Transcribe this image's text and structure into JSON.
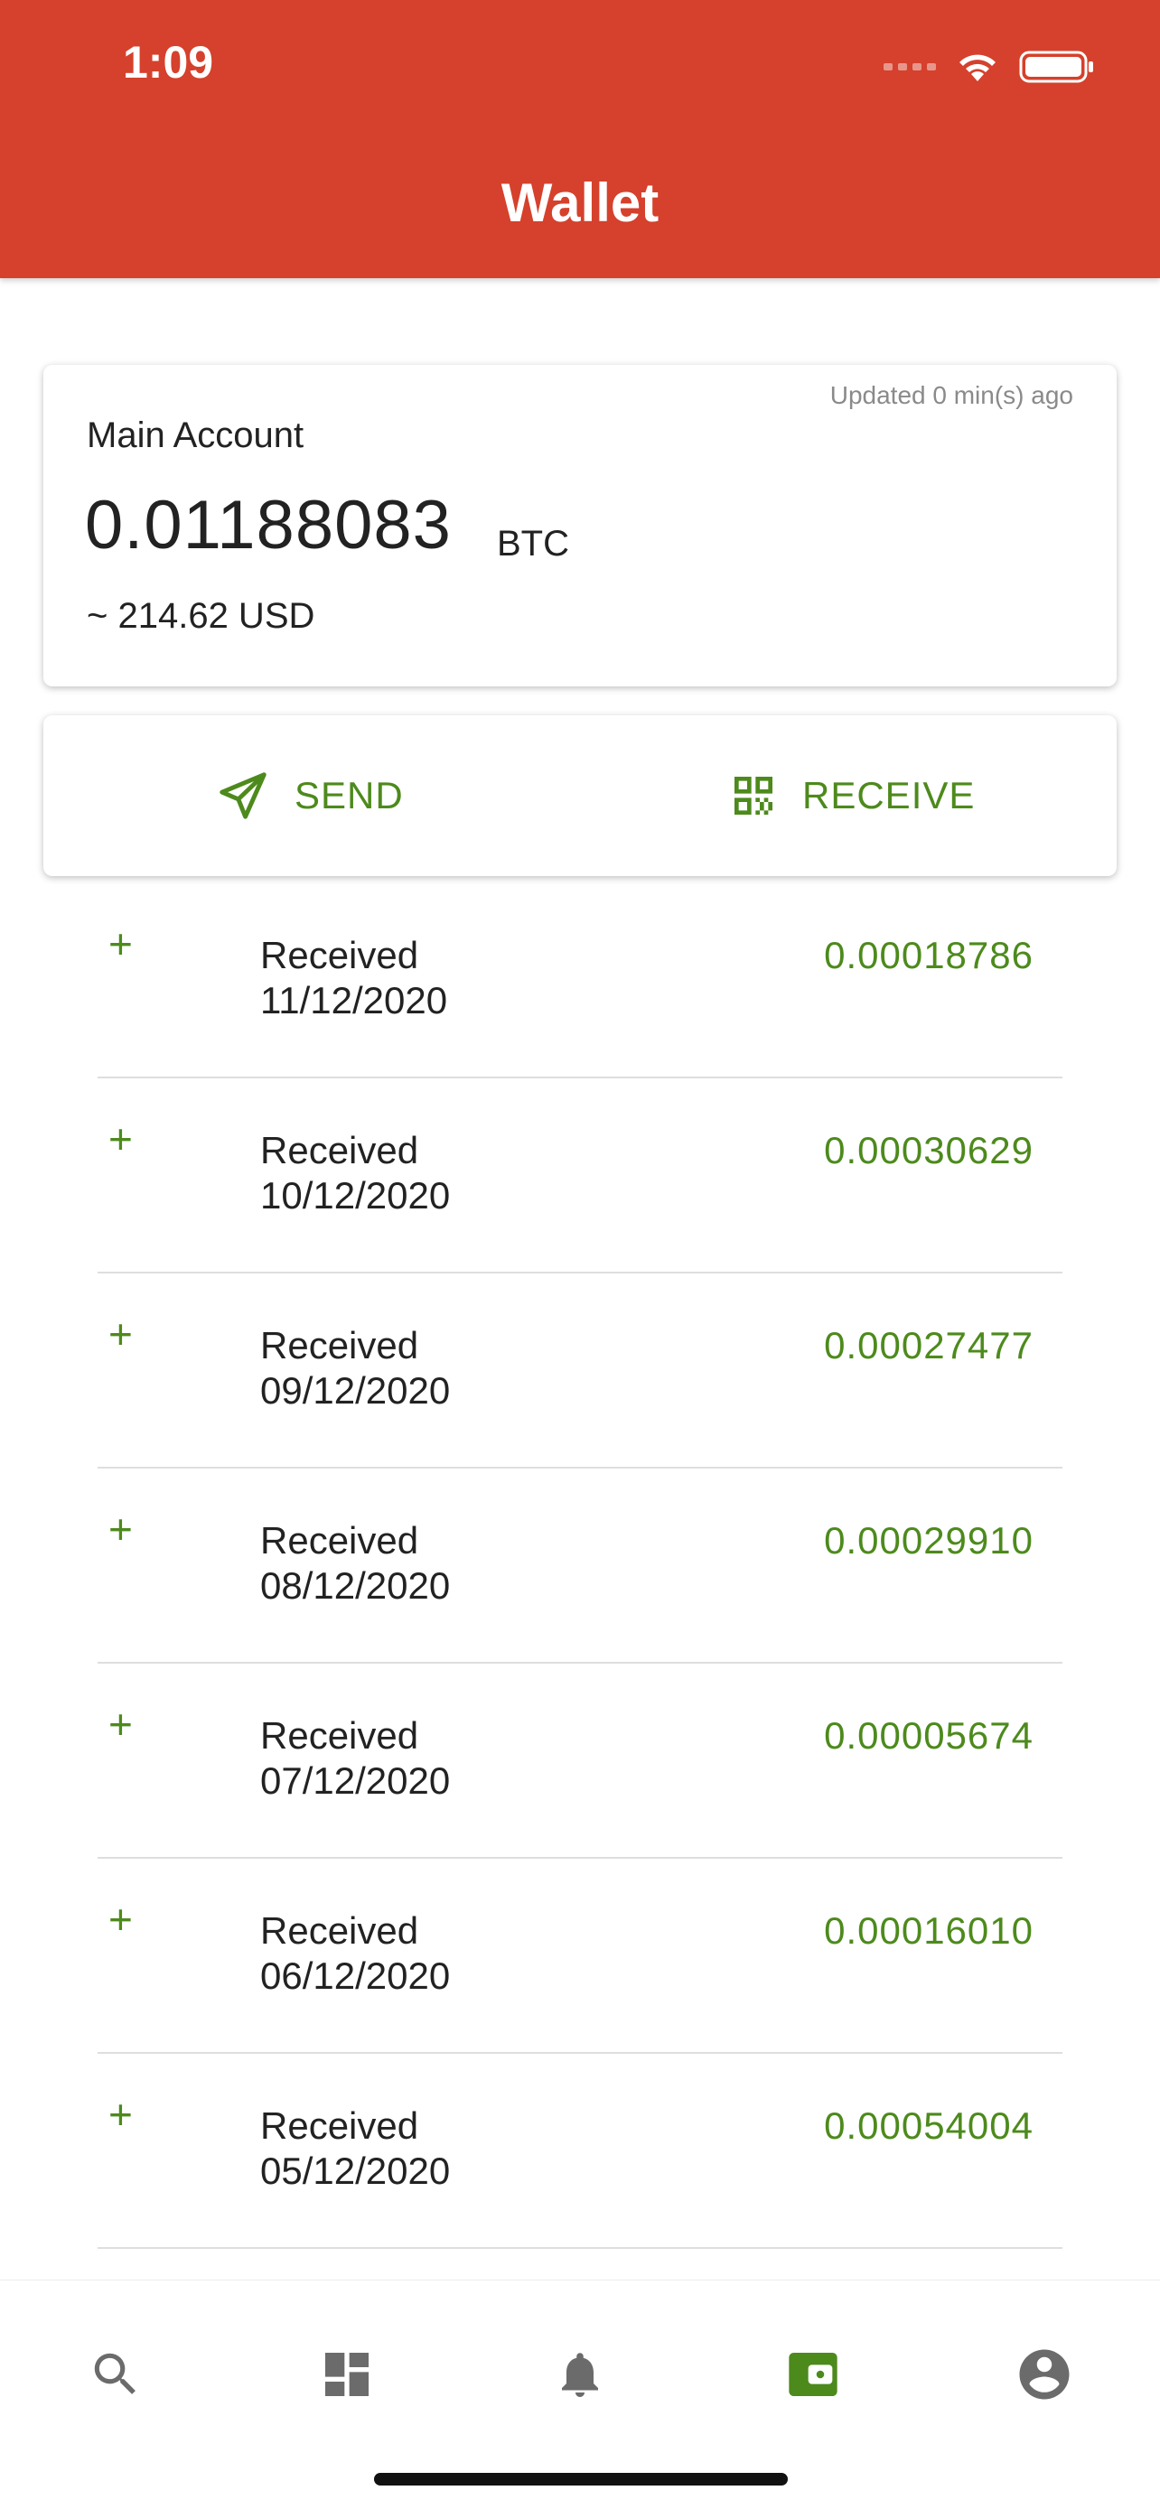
{
  "status_bar": {
    "time": "1:09"
  },
  "header": {
    "title": "Wallet"
  },
  "balance": {
    "updated": "Updated 0 min(s) ago",
    "account_name": "Main Account",
    "amount": "0.01188083",
    "unit": "BTC",
    "usd": "~ 214.62 USD"
  },
  "actions": {
    "send_label": "SEND",
    "receive_label": "RECEIVE"
  },
  "transactions": [
    {
      "sign": "+",
      "type": "Received",
      "date": "11/12/2020",
      "amount": "0.00018786"
    },
    {
      "sign": "+",
      "type": "Received",
      "date": "10/12/2020",
      "amount": "0.00030629"
    },
    {
      "sign": "+",
      "type": "Received",
      "date": "09/12/2020",
      "amount": "0.00027477"
    },
    {
      "sign": "+",
      "type": "Received",
      "date": "08/12/2020",
      "amount": "0.00029910"
    },
    {
      "sign": "+",
      "type": "Received",
      "date": "07/12/2020",
      "amount": "0.00005674"
    },
    {
      "sign": "+",
      "type": "Received",
      "date": "06/12/2020",
      "amount": "0.00016010"
    },
    {
      "sign": "+",
      "type": "Received",
      "date": "05/12/2020",
      "amount": "0.00054004"
    }
  ],
  "bottom_nav": {
    "items": [
      {
        "icon": "search-icon",
        "active": false
      },
      {
        "icon": "dashboard-icon",
        "active": false
      },
      {
        "icon": "bell-icon",
        "active": false
      },
      {
        "icon": "wallet-icon",
        "active": true
      },
      {
        "icon": "account-circle-icon",
        "active": false
      }
    ]
  },
  "colors": {
    "header": "#d5412c",
    "accent": "#4d8a1c",
    "nav_inactive": "#6b6b6b"
  }
}
